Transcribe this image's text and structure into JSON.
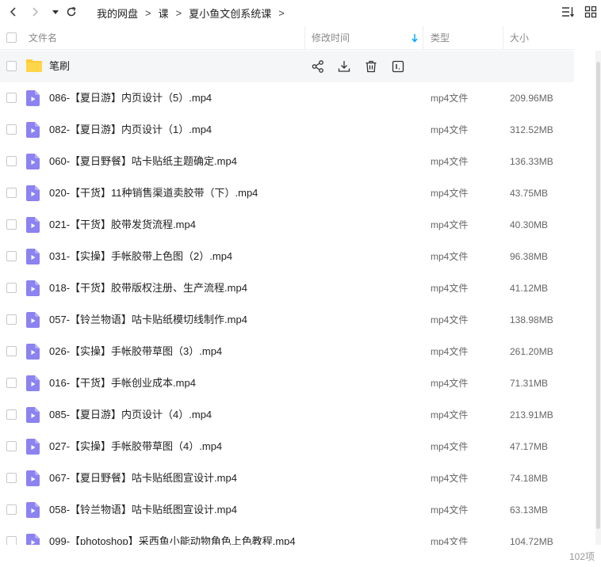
{
  "breadcrumb": [
    "我的网盘",
    "课",
    "夏小鱼文创系统课"
  ],
  "columns": {
    "name": "文件名",
    "modified": "修改时间",
    "type": "类型",
    "size": "大小"
  },
  "folder": {
    "name": "笔刷"
  },
  "files": [
    {
      "name": "086-【夏日游】内页设计（5）.mp4",
      "type": "mp4文件",
      "size": "209.96MB"
    },
    {
      "name": "082-【夏日游】内页设计（1）.mp4",
      "type": "mp4文件",
      "size": "312.52MB"
    },
    {
      "name": "060-【夏日野餐】咕卡贴纸主题确定.mp4",
      "type": "mp4文件",
      "size": "136.33MB"
    },
    {
      "name": "020-【干货】11种销售渠道卖胶带（下）.mp4",
      "type": "mp4文件",
      "size": "43.75MB"
    },
    {
      "name": "021-【干货】胶带发货流程.mp4",
      "type": "mp4文件",
      "size": "40.30MB"
    },
    {
      "name": "031-【实操】手帐胶带上色图（2）.mp4",
      "type": "mp4文件",
      "size": "96.38MB"
    },
    {
      "name": "018-【干货】胶带版权注册、生产流程.mp4",
      "type": "mp4文件",
      "size": "41.12MB"
    },
    {
      "name": "057-【铃兰物语】咕卡贴纸模切线制作.mp4",
      "type": "mp4文件",
      "size": "138.98MB"
    },
    {
      "name": "026-【实操】手帐胶带草图（3）.mp4",
      "type": "mp4文件",
      "size": "261.20MB"
    },
    {
      "name": "016-【干货】手帐创业成本.mp4",
      "type": "mp4文件",
      "size": "71.31MB"
    },
    {
      "name": "085-【夏日游】内页设计（4）.mp4",
      "type": "mp4文件",
      "size": "213.91MB"
    },
    {
      "name": "027-【实操】手帐胶带草图（4）.mp4",
      "type": "mp4文件",
      "size": "47.17MB"
    },
    {
      "name": "067-【夏日野餐】咕卡贴纸图宣设计.mp4",
      "type": "mp4文件",
      "size": "74.18MB"
    },
    {
      "name": "058-【铃兰物语】咕卡贴纸图宣设计.mp4",
      "type": "mp4文件",
      "size": "63.13MB"
    },
    {
      "name": "099-【photoshop】采西鱼小能动物角色上色教程.mp4",
      "type": "mp4文件",
      "size": "104.72MB"
    }
  ],
  "item_count": "102项",
  "colors": {
    "accent": "#06a7ff",
    "folder": "#ffcc33",
    "video_icon": "#8c82f0"
  },
  "icons": [
    "back-icon",
    "forward-icon",
    "dropdown-icon",
    "refresh-icon",
    "sort-icon",
    "grid-view-icon",
    "share-icon",
    "download-icon",
    "delete-icon",
    "more-icon",
    "sort-down-icon"
  ]
}
